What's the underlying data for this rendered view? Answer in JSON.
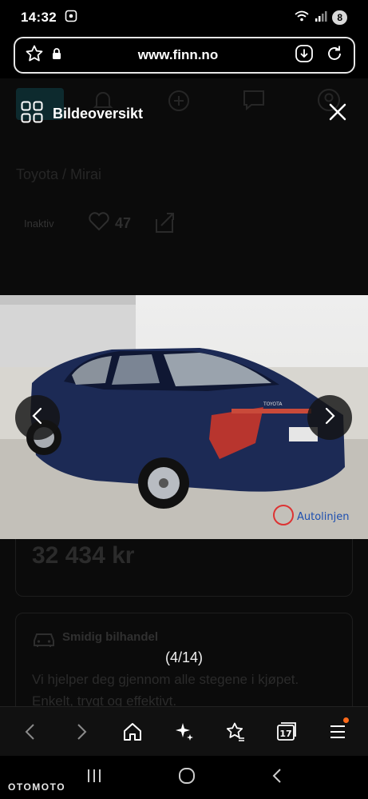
{
  "status_bar": {
    "time": "14:32",
    "battery": "8"
  },
  "browser": {
    "url": "www.finn.no"
  },
  "page": {
    "breadcrumb": "Toyota  /  Mirai",
    "status": "Inaktiv",
    "likes": "47",
    "price": "32 434 kr",
    "info_title": "Smidig bilhandel",
    "info_body": "Vi hjelper deg gjennom alle stegene i kjøpet. Enkelt, trygt og effektivt."
  },
  "overlay": {
    "title": "Bildeoversikt",
    "counter": "(4/14)",
    "photo_text": {
      "brand_plate": "TOYOTA",
      "dealer": "Autolinjen"
    }
  },
  "watermark": "OTOMOTO",
  "toolbar": {
    "tabs_count": "17"
  },
  "colors": {
    "background": "#000000",
    "accent_dot": "#ff6a1a",
    "car_body": "#1c2a55"
  }
}
